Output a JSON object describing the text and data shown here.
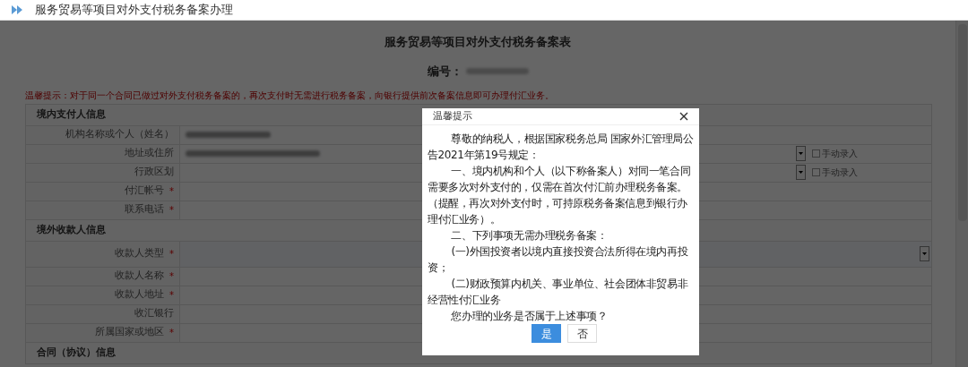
{
  "header": {
    "title": "服务贸易等项目对外支付税务备案办理"
  },
  "form": {
    "title": "服务贸易等项目对外支付税务备案表",
    "number_label": "编号：",
    "number_blurred": true,
    "notice": "温馨提示：对于同一个合同已做过对外支付税务备案的，再次支付时无需进行税务备案，向银行提供前次备案信息即可办理付汇业务。",
    "sections": [
      {
        "title": "境内支付人信息",
        "rows": [
          {
            "label": "机构名称或个人（姓名）",
            "kind": "text",
            "blurred": true
          },
          {
            "label": "地址或住所",
            "kind": "select",
            "blurred": true,
            "manual_entry": {
              "label": "手动录入",
              "checked": false
            }
          },
          {
            "label": "行政区划",
            "kind": "select",
            "blurred": false,
            "manual_entry": {
              "label": "手动录入",
              "checked": false
            }
          },
          {
            "label": "付汇帐号",
            "required_mark": "*",
            "kind": "text",
            "blurred": false
          },
          {
            "label": "联系电话",
            "required_mark": "*",
            "kind": "text",
            "blurred": false
          }
        ]
      },
      {
        "title": "境外收款人信息",
        "rows": [
          {
            "label": "收款人类型",
            "required_mark": "*",
            "kind": "select",
            "blurred": false
          },
          {
            "label": "收款人名称",
            "required_mark": "*",
            "kind": "text",
            "blurred": false
          },
          {
            "label": "收款人地址",
            "required_mark": "*",
            "kind": "text",
            "blurred": false
          },
          {
            "label": "收汇银行",
            "kind": "text",
            "blurred": false
          },
          {
            "label": "所属国家或地区",
            "required_mark": "*",
            "kind": "text",
            "blurred": false
          }
        ]
      },
      {
        "title": "合同（协议）信息"
      }
    ]
  },
  "dialog": {
    "title": "温馨提示",
    "paragraphs": [
      "尊敬的纳税人，根据国家税务总局 国家外汇管理局公告2021年第19号规定：",
      "一、境内机构和个人（以下称备案人）对同一笔合同需要多次对外支付的，仅需在首次付汇前办理税务备案。（提醒，再次对外支付时，可持原税务备案信息到银行办理付汇业务）。",
      "二、下列事项无需办理税务备案：",
      "(一)外国投资者以境内直接投资合法所得在境内再投资；",
      "(二)财政预算内机关、事业单位、社会团体非贸易非经营性付汇业务",
      "您办理的业务是否属于上述事项？"
    ],
    "buttons": [
      {
        "label": "是",
        "primary": true
      },
      {
        "label": "否",
        "primary": false
      }
    ]
  }
}
